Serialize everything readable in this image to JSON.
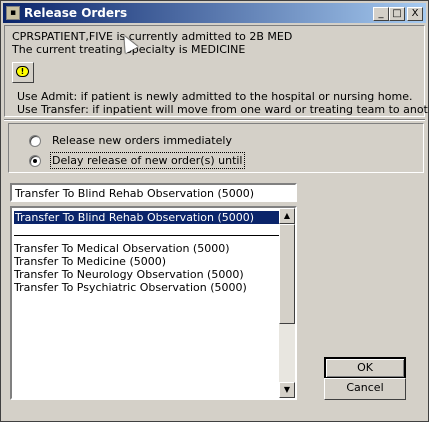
{
  "window": {
    "title": "Release Orders",
    "icon": "app-icon",
    "controls": {
      "minimize": "_",
      "maximize": "□",
      "close": "X"
    }
  },
  "info": {
    "line1": "CPRSPATIENT,FIVE is currently admitted to 2B MED",
    "line2": "The current treating specialty is MEDICINE",
    "help_admit": "Use Admit: if patient is newly admitted to the hospital or nursing home.",
    "help_transfer": "Use Transfer: if inpatient will move from one ward or treating team to another."
  },
  "options": {
    "release_now": "Release new orders immediately",
    "delay": "Delay release of new order(s) until",
    "selected": "delay"
  },
  "event": {
    "combo_value": "Transfer To Blind Rehab Observation (5000)",
    "list_items": [
      {
        "label": "Transfer To Blind Rehab Observation (5000)",
        "selected": true
      },
      {
        "label": "Transfer To Medical Observation (5000)",
        "selected": false
      },
      {
        "label": "Transfer To Medicine (5000)",
        "selected": false
      },
      {
        "label": "Transfer To Neurology Observation (5000)",
        "selected": false
      },
      {
        "label": "Transfer To Psychiatric Observation (5000)",
        "selected": false
      }
    ]
  },
  "buttons": {
    "ok": "OK",
    "cancel": "Cancel"
  },
  "colors": {
    "selection": "#0a246a",
    "face": "#d4d0c8",
    "title_gradient_end": "#a6caf0"
  }
}
